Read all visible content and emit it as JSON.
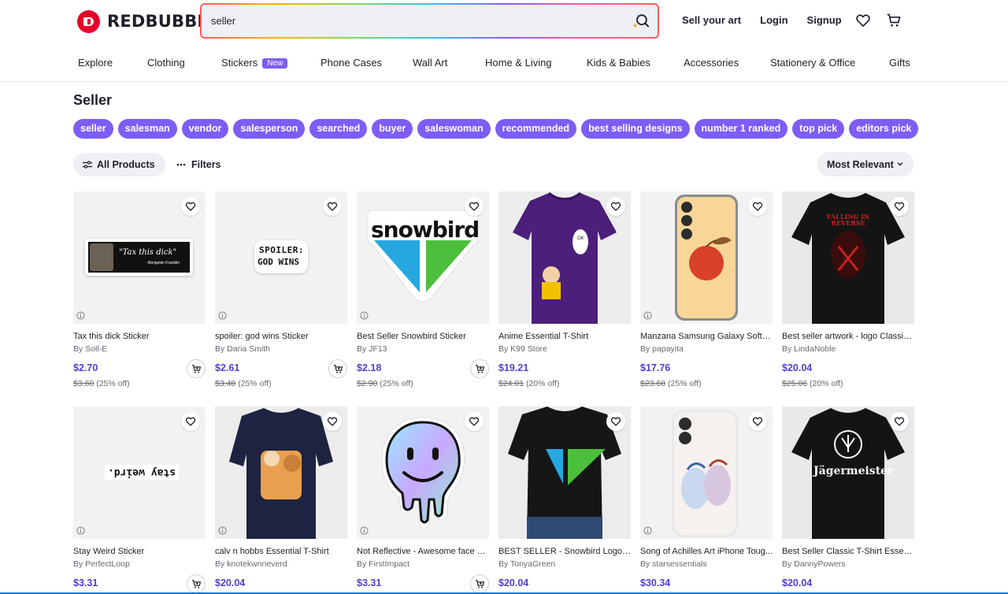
{
  "brand": {
    "name": "REDBUBBLE",
    "accent": "#7d5df5",
    "price_color": "#4e3fd1",
    "logo_red": "#e4002b"
  },
  "search": {
    "value": "seller",
    "icon": "search-sparkle-icon"
  },
  "header_links": [
    "Sell your art",
    "Login",
    "Signup"
  ],
  "header_icons": [
    "heart-icon",
    "cart-icon"
  ],
  "nav": {
    "items": [
      "Explore",
      "Clothing",
      "Stickers",
      "Phone Cases",
      "Wall Art",
      "Home & Living",
      "Kids & Babies",
      "Accessories",
      "Stationery & Office",
      "Gifts"
    ],
    "new_badge": "New"
  },
  "page": {
    "title": "Seller"
  },
  "chips": [
    "seller",
    "salesman",
    "vendor",
    "salesperson",
    "searched",
    "buyer",
    "saleswoman",
    "recommended",
    "best selling designs",
    "number 1 ranked",
    "top pick",
    "editors pick"
  ],
  "filters": {
    "all_products": "All Products",
    "filters": "Filters",
    "sort": "Most Relevant"
  },
  "products": [
    {
      "title": "Tax this dick Sticker",
      "artist": "By Soll-E",
      "price": "$2.70",
      "old_price": "$3.60",
      "discount": "(25% off)",
      "image_text": "\"Tax this dick\"",
      "image_subtext": "- Benjamin Franklin"
    },
    {
      "title": "spoiler: god wins Sticker",
      "artist": "By Daria Smith",
      "price": "$2.61",
      "old_price": "$3.48",
      "discount": "(25% off)",
      "image_text": "SPOILER:",
      "image_subtext": "GOD WINS"
    },
    {
      "title": "Best Seller Snowbird Sticker",
      "artist": "By JF13",
      "price": "$2.18",
      "old_price": "$2.90",
      "discount": "(25% off)",
      "image_text": "snowbird"
    },
    {
      "title": "Anime Essential T-Shirt",
      "artist": "By K99 Store",
      "price": "$19.21",
      "old_price": "$24.01",
      "discount": "(20% off)",
      "image_text": "OK"
    },
    {
      "title": "Manzana Samsung Galaxy Soft C...",
      "artist": "By papayita",
      "price": "$17.76",
      "old_price": "$23.68",
      "discount": "(25% off)"
    },
    {
      "title": "Best seller artwork - logo Classic ...",
      "artist": "By LindaNoble",
      "price": "$20.04",
      "old_price": "$25.06",
      "discount": "(20% off)",
      "image_text": "FALLING IN REVERSE"
    },
    {
      "title": "Stay Weird Sticker",
      "artist": "By PerfectLoop",
      "price": "$3.31",
      "image_text": "stay weird."
    },
    {
      "title": "calv n hobbs Essential T-Shirt",
      "artist": "By knotekwnneverd",
      "price": "$20.04"
    },
    {
      "title": "Not Reflective - Awesome face Sti...",
      "artist": "By FirstImpact",
      "price": "$3.31"
    },
    {
      "title": "BEST SELLER - Snowbird Logo Me...",
      "artist": "By TonyaGreen",
      "price": "$20.04"
    },
    {
      "title": "Song of Achilles Art iPhone Toug...",
      "artist": "By starsessentials",
      "price": "$30.34"
    },
    {
      "title": "Best Seller Classic T-Shirt Essentia...",
      "artist": "By DannyPowers",
      "price": "$20.04",
      "image_text": "Jägermeister"
    }
  ]
}
